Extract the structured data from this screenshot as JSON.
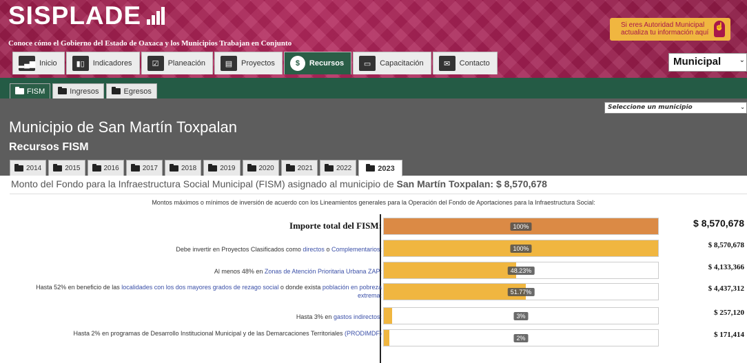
{
  "header": {
    "brand": "SISPLADE",
    "tagline": "Conoce cómo el Gobierno del Estado de Oaxaca y los Municipios Trabajan en Conjunto",
    "authority_line1": "Si eres Autoridad Municipal",
    "authority_line2": "actualiza tu información aquí",
    "region_select": "Municipal",
    "nav": [
      {
        "label": "Inicio",
        "icon": "bar-chart-icon"
      },
      {
        "label": "Indicadores",
        "icon": "indicators-icon"
      },
      {
        "label": "Planeación",
        "icon": "checklist-icon"
      },
      {
        "label": "Proyectos",
        "icon": "clipboard-icon"
      },
      {
        "label": "Recursos",
        "icon": "dollar-icon",
        "active": true
      },
      {
        "label": "Capacitación",
        "icon": "presentation-icon"
      },
      {
        "label": "Contacto",
        "icon": "envelope-icon"
      }
    ]
  },
  "subtabs": [
    {
      "label": "FISM",
      "active": true
    },
    {
      "label": "Ingresos"
    },
    {
      "label": "Egresos"
    }
  ],
  "municipio_select": "Seleccione un municipio",
  "municipio_title": "Municipio de San Martín Toxpalan",
  "section_title": "Recursos FISM",
  "years": [
    "2014",
    "2015",
    "2016",
    "2017",
    "2018",
    "2019",
    "2020",
    "2021",
    "2022",
    "2023"
  ],
  "active_year": "2023",
  "monto": {
    "prefix": "Monto del Fondo para la Infraestructura Social Municipal (FISM) asignado al municipio de ",
    "municipio": "San Martín Toxpalan:",
    "amount": "$ 8,570,678"
  },
  "intro": "Montos máximos o mínimos de inversión de acuerdo con los Lineamientos generales para la Operación del Fondo de Aportaciones para la Infraestructura Social:",
  "rows": [
    {
      "label_parts": [
        {
          "t": "Importe total del FISM:"
        }
      ],
      "percent_label": "100%",
      "percent": 100,
      "amount": "$ 8,570,678",
      "big": true
    },
    {
      "label_parts": [
        {
          "t": "Debe invertir en Proyectos Clasificados como "
        },
        {
          "t": "directos",
          "link": true
        },
        {
          "t": " o "
        },
        {
          "t": "Complementarios",
          "link": true
        },
        {
          "t": ":"
        }
      ],
      "percent_label": "100%",
      "percent": 100,
      "amount": "$ 8,570,678"
    },
    {
      "label_parts": [
        {
          "t": "Al menos 48% en "
        },
        {
          "t": "Zonas de Atención Prioritaria Urbana ZAP",
          "link": true
        },
        {
          "t": ":"
        }
      ],
      "percent_label": "48.23%",
      "percent": 48.23,
      "amount": "$ 4,133,366"
    },
    {
      "label_parts": [
        {
          "t": "Hasta 52% en beneficio de las "
        },
        {
          "t": "localidades con los dos mayores grados de rezago social",
          "link": true
        },
        {
          "t": " o donde exista "
        },
        {
          "t": "población en pobreza extrema",
          "link": true
        },
        {
          "t": ":"
        }
      ],
      "percent_label": "51.77%",
      "percent": 51.77,
      "amount": "$ 4,437,312"
    },
    {
      "label_parts": [
        {
          "t": "Hasta 3% en "
        },
        {
          "t": "gastos indirectos",
          "link": true
        },
        {
          "t": ":"
        }
      ],
      "percent_label": "3%",
      "percent": 3,
      "amount": "$ 257,120"
    },
    {
      "label_parts": [
        {
          "t": "Hasta 2% en programas de Desarrollo Institucional Municipal y de las Demarcaciones Territoriales "
        },
        {
          "t": "(PRODIMDF)",
          "link": true
        }
      ],
      "percent_label": "2%",
      "percent": 2,
      "amount": "$ 171,414"
    }
  ],
  "colors": {
    "total_fill": "#db8a45",
    "fill": "#f0b640",
    "green": "#245b45",
    "maroon": "#a8184a"
  }
}
